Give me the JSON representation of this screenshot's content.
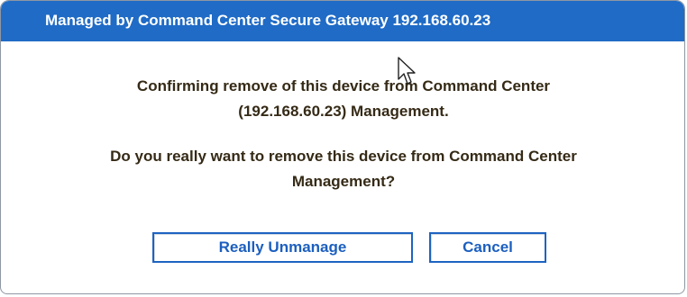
{
  "dialog": {
    "title": "Managed by Command Center Secure Gateway 192.168.60.23",
    "message_line1": "Confirming remove of this device from Command Center",
    "message_line2": "(192.168.60.23) Management.",
    "question_line1": "Do you really want to remove this device from Command Center",
    "question_line2": "Management?",
    "primary_button": "Really Unmanage",
    "cancel_button": "Cancel"
  },
  "colors": {
    "titlebar": "#1f6bc6",
    "button_text": "#1c5fbf",
    "message_text": "#352a16"
  },
  "icons": {
    "pointer": "mouse-pointer-icon"
  }
}
